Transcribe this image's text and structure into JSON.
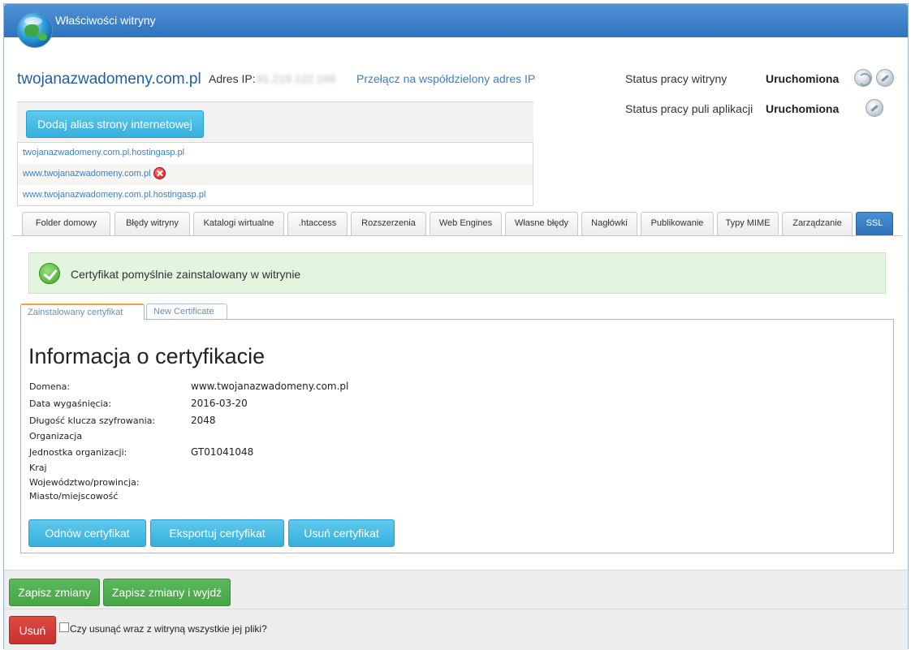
{
  "window": {
    "title": "Właściwości witryny",
    "logo_icon": "globe-icon"
  },
  "site": {
    "domain": "twojanazwadomeny.com.pl",
    "ip_label": "Adres IP:",
    "ip_value": "91.219.122.169",
    "switch_ip_link": "Przełącz na współdzielony adres IP"
  },
  "status": {
    "site_label": "Status pracy witryny",
    "site_value": "Uruchomiona",
    "pool_label": "Status pracy puli aplikacji",
    "pool_value": "Uruchomiona"
  },
  "alias": {
    "add_button": "Dodaj alias strony internetowej",
    "items": [
      "twojanazwadomeny.com.pl.hostingasp.pl",
      "www.twojanazwadomeny.com.pl",
      "www.twojanazwadomeny.com.pl.hostingasp.pl"
    ]
  },
  "tabs": [
    "Folder domowy",
    "Błędy witryny",
    "Katalogi wirtualne",
    ".htaccess",
    "Rozszerzenia",
    "Web Engines",
    "Własne błędy",
    "Nagłówki",
    "Publikowanie",
    "Typy MIME",
    "Zarządzanie",
    "SSL"
  ],
  "active_tab": "SSL",
  "alert": {
    "text": "Certyfikat pomyślnie zainstalowany w witrynie"
  },
  "subtabs": {
    "installed": "Zainstalowany certyfikat",
    "new": "New Certificate"
  },
  "certificate": {
    "title": "Informacja o certyfikacie",
    "domain_label": "Domena:",
    "domain_value": "www.twojanazwadomeny.com.pl",
    "expiry_label": "Data wygaśnięcia:",
    "expiry_value": "2016-03-20",
    "key_label": "Długość klucza szyfrowania:",
    "key_value": "2048",
    "org_label": "Organizacja",
    "unit_label": "Jednostka organizacji:",
    "unit_value": "GT01041048",
    "country_label": "Kraj",
    "province_label": "Województwo/prowincja:",
    "city_label": "Miasto/miejscowość",
    "renew_button": "Odnów certyfikat",
    "export_button": "Eksportuj certyfikat",
    "delete_button": "Usuń certyfikat"
  },
  "footer": {
    "save_button": "Zapisz zmiany",
    "save_exit_button": "Zapisz zmiany i wyjdź",
    "delete_button": "Usuń",
    "delete_files_label": "Czy usunąć wraz z witryną wszystkie jej pliki?"
  }
}
